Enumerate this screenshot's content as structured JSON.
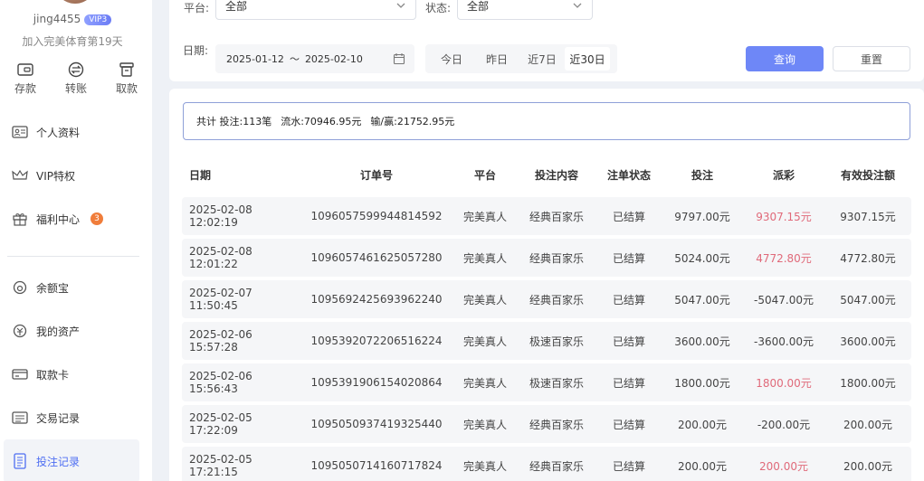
{
  "user": {
    "name": "jing4455",
    "vip": "VIP3",
    "joined": "加入完美体育第19天"
  },
  "quick_actions": [
    {
      "label": "存款",
      "icon": "deposit-icon"
    },
    {
      "label": "转账",
      "icon": "transfer-icon"
    },
    {
      "label": "取款",
      "icon": "withdraw-icon"
    }
  ],
  "menu_top": [
    {
      "label": "个人资料",
      "icon": "id-card-icon"
    },
    {
      "label": "VIP特权",
      "icon": "crown-icon"
    },
    {
      "label": "福利中心",
      "icon": "gift-icon",
      "badge": "3"
    }
  ],
  "menu_bottom": [
    {
      "label": "余额宝",
      "icon": "balance-icon"
    },
    {
      "label": "我的资产",
      "icon": "assets-icon"
    },
    {
      "label": "取款卡",
      "icon": "card-icon"
    },
    {
      "label": "交易记录",
      "icon": "transactions-icon"
    },
    {
      "label": "投注记录",
      "icon": "bet-records-icon",
      "active": true
    }
  ],
  "filters": {
    "platform_label": "平台:",
    "platform_value": "全部",
    "status_label": "状态:",
    "status_value": "全部",
    "date_label": "日期:",
    "date_start": "2025-01-12",
    "date_sep": "～",
    "date_end": "2025-02-10",
    "quick_dates": [
      "今日",
      "昨日",
      "近7日",
      "近30日"
    ],
    "quick_date_active": 3,
    "query_label": "查询",
    "reset_label": "重置"
  },
  "summary": {
    "total": "共计 投注:113笔",
    "turnover": "流水:70946.95元",
    "winloss": "输/赢:21752.95元"
  },
  "table": {
    "headers": [
      "日期",
      "订单号",
      "平台",
      "投注内容",
      "注单状态",
      "投注",
      "派彩",
      "有效投注额"
    ],
    "rows": [
      [
        "2025-02-08 12:02:19",
        "1096057599944814592",
        "完美真人",
        "经典百家乐",
        "已结算",
        "9797.00元",
        "9307.15元",
        "9307.15元"
      ],
      [
        "2025-02-08 12:01:22",
        "1096057461625057280",
        "完美真人",
        "经典百家乐",
        "已结算",
        "5024.00元",
        "4772.80元",
        "4772.80元"
      ],
      [
        "2025-02-07 11:50:45",
        "1095692425693962240",
        "完美真人",
        "经典百家乐",
        "已结算",
        "5047.00元",
        "-5047.00元",
        "5047.00元"
      ],
      [
        "2025-02-06 15:57:28",
        "1095392072206516224",
        "完美真人",
        "极速百家乐",
        "已结算",
        "3600.00元",
        "-3600.00元",
        "3600.00元"
      ],
      [
        "2025-02-06 15:56:43",
        "1095391906154020864",
        "完美真人",
        "极速百家乐",
        "已结算",
        "1800.00元",
        "1800.00元",
        "1800.00元"
      ],
      [
        "2025-02-05 17:22:09",
        "1095050937419325440",
        "完美真人",
        "经典百家乐",
        "已结算",
        "200.00元",
        "-200.00元",
        "200.00元"
      ],
      [
        "2025-02-05 17:21:15",
        "1095050714160717824",
        "完美真人",
        "经典百家乐",
        "已结算",
        "200.00元",
        "200.00元",
        "200.00元"
      ]
    ],
    "payout_positive_color": "#e06a7a"
  }
}
